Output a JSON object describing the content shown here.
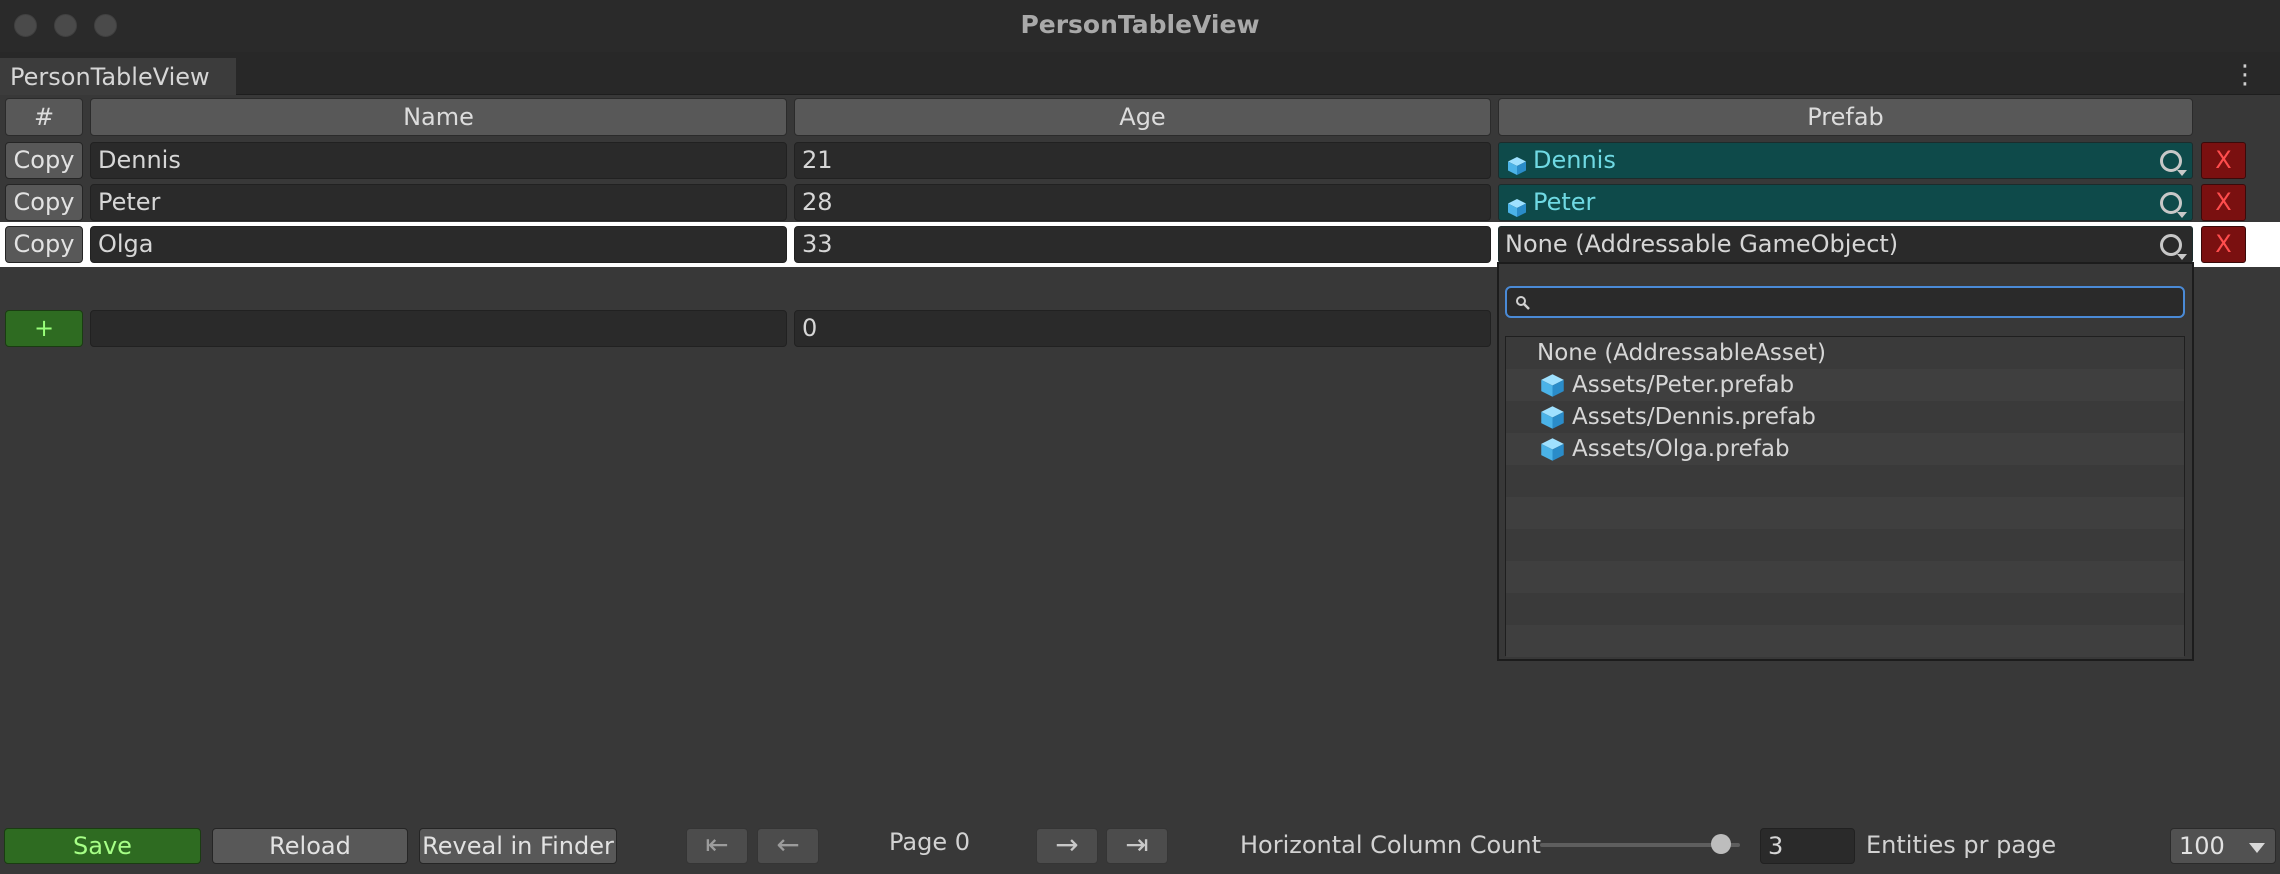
{
  "window": {
    "title": "PersonTableView",
    "tab": "PersonTableView"
  },
  "columns": {
    "index": "#",
    "name": "Name",
    "age": "Age",
    "prefab": "Prefab"
  },
  "rows": [
    {
      "copy": "Copy",
      "name": "Dennis",
      "age": "21",
      "prefab": "Dennis",
      "delete": "X"
    },
    {
      "copy": "Copy",
      "name": "Peter",
      "age": "28",
      "prefab": "Peter",
      "delete": "X"
    },
    {
      "copy": "Copy",
      "name": "Olga",
      "age": "33",
      "prefab": "None (Addressable GameObject)",
      "delete": "X"
    }
  ],
  "new_row": {
    "add": "+",
    "name": "",
    "age": "0"
  },
  "dropdown": {
    "search_placeholder": "",
    "items": [
      {
        "label": "None (AddressableAsset)"
      },
      {
        "label": "Assets/Peter.prefab",
        "icon": "prefab-cube-icon"
      },
      {
        "label": "Assets/Dennis.prefab",
        "icon": "prefab-cube-icon"
      },
      {
        "label": "Assets/Olga.prefab",
        "icon": "prefab-cube-icon"
      }
    ]
  },
  "footer": {
    "save": "Save",
    "reload": "Reload",
    "reveal": "Reveal in Finder",
    "first": "⇤",
    "prev": "←",
    "page": "Page 0",
    "next": "→",
    "last": "⇥",
    "hcol_label": "Horizontal Column Count",
    "hcol_value": "3",
    "slider_level": 0.95,
    "entities_label": "Entities pr page",
    "entities_value": "100"
  },
  "colors": {
    "accent": "#4a8ad6",
    "prefab_field": "#0e4a4a",
    "delete": "#7a1010",
    "save": "#2e6b21"
  }
}
